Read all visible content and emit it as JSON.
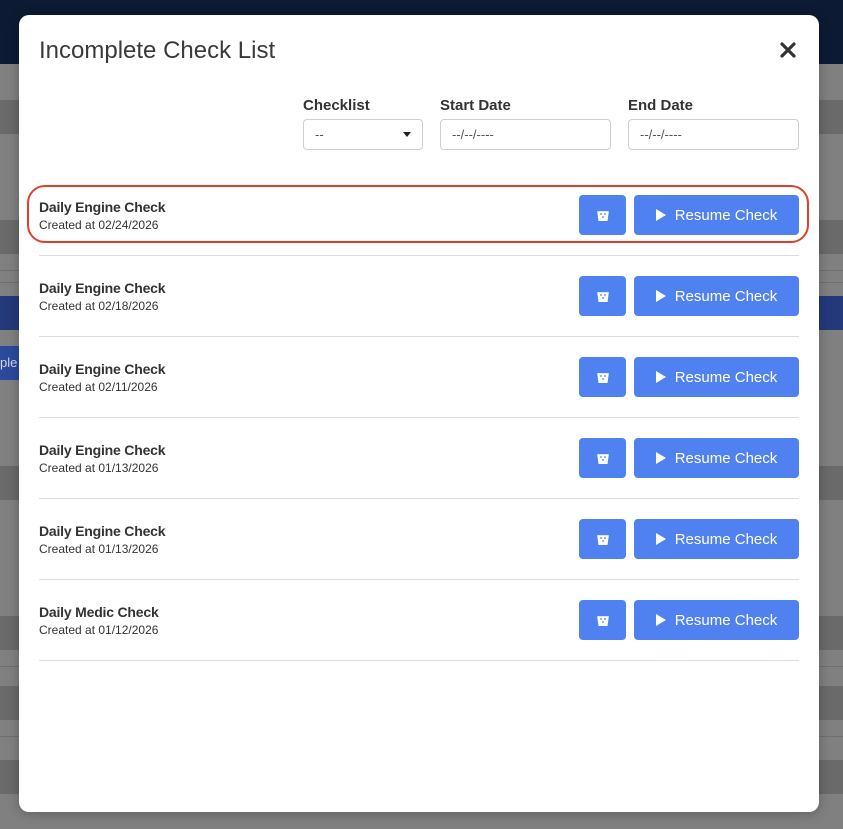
{
  "modal": {
    "title": "Incomplete Check List"
  },
  "filters": {
    "checklist_label": "Checklist",
    "checklist_value": "--",
    "start_date_label": "Start Date",
    "start_date_placeholder": "--/--/----",
    "end_date_label": "End Date",
    "end_date_placeholder": "--/--/----"
  },
  "checks": [
    {
      "title": "Daily Engine Check",
      "created": "Created at 02/24/2026"
    },
    {
      "title": "Daily Engine Check",
      "created": "Created at 02/18/2026"
    },
    {
      "title": "Daily Engine Check",
      "created": "Created at 02/11/2026"
    },
    {
      "title": "Daily Engine Check",
      "created": "Created at 01/13/2026"
    },
    {
      "title": "Daily Engine Check",
      "created": "Created at 01/13/2026"
    },
    {
      "title": "Daily Medic Check",
      "created": "Created at 01/12/2026"
    }
  ],
  "actions": {
    "resume_label": "Resume Check"
  },
  "backdrop": {
    "chip_text": "ple"
  },
  "colors": {
    "accent": "#4f81f0",
    "highlight": "#e0402a"
  },
  "icons": {
    "close": "close-icon",
    "delete": "trash-icon",
    "resume": "play-icon",
    "dropdown": "chevron-down-icon"
  }
}
